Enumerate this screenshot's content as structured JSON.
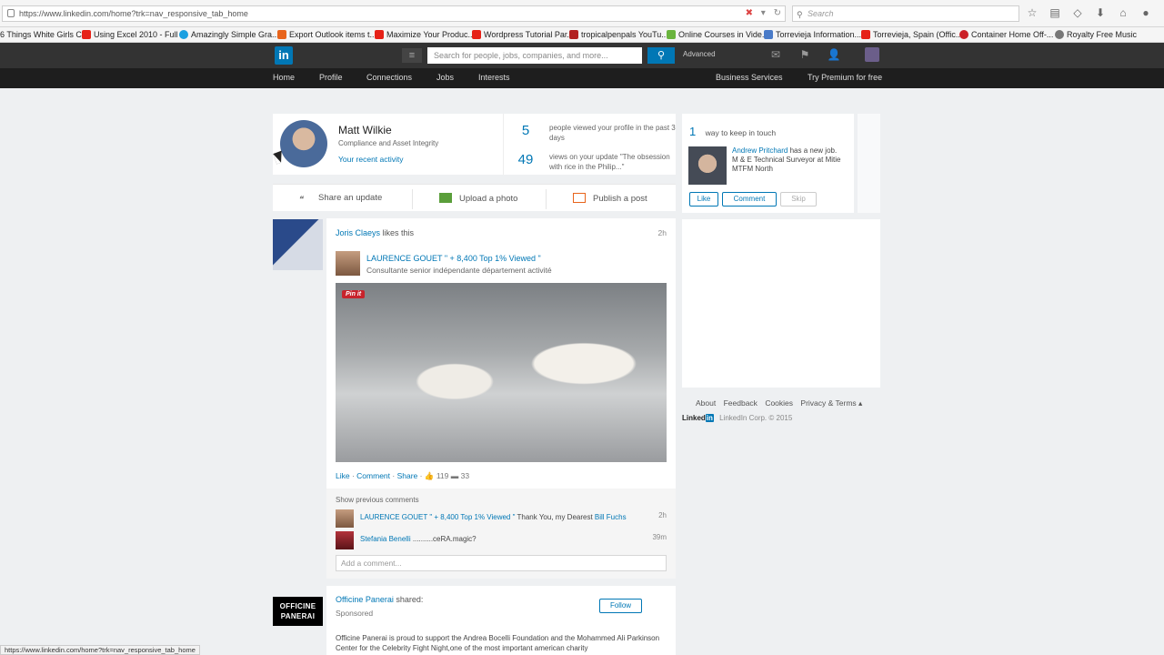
{
  "browser": {
    "url": "https://www.linkedin.com/home?trk=nav_responsive_tab_home",
    "search_placeholder": "Search",
    "status_url": "https://www.linkedin.com/home?trk=nav_responsive_tab_home",
    "bookmarks": [
      {
        "label": "6 Things White Girls C...",
        "color": "#ffffff"
      },
      {
        "label": "Using Excel 2010 - Full ...",
        "color": "#e62117"
      },
      {
        "label": "Amazingly Simple Gra...",
        "color": "#1ba0e1"
      },
      {
        "label": "Export Outlook items t...",
        "color": "#e8641b"
      },
      {
        "label": "Maximize Your Produc...",
        "color": "#e62117"
      },
      {
        "label": "Wordpress Tutorial Par...",
        "color": "#e62117"
      },
      {
        "label": "tropicalpenpals YouTu...",
        "color": "#b22222"
      },
      {
        "label": "Online Courses in Vide...",
        "color": "#6ab43e"
      },
      {
        "label": "Torrevieja Information...",
        "color": "#4a7bc8"
      },
      {
        "label": "Torrevieja, Spain (Offic...",
        "color": "#e62117"
      },
      {
        "label": "Container Home Off-...",
        "color": "#cb2027"
      },
      {
        "label": "Royalty Free Music",
        "color": "#777777"
      }
    ]
  },
  "nav": {
    "logo": "in",
    "search_placeholder": "Search for people, jobs, companies, and more...",
    "advanced": "Advanced",
    "tabs": [
      "Home",
      "Profile",
      "Connections",
      "Jobs",
      "Interests"
    ],
    "business": "Business Services",
    "premium": "Try Premium for free"
  },
  "profile": {
    "name": "Matt Wilkie",
    "headline": "Compliance and Asset Integrity",
    "activity": "Your recent activity",
    "stat1_num": "5",
    "stat1_text": "people viewed your profile in the past 3 days",
    "stat2_num": "49",
    "stat2_text": "views on your update \"The obsession with rice in the Philip...\""
  },
  "share": {
    "update": "Share an update",
    "photo": "Upload a photo",
    "post": "Publish a post"
  },
  "feed": {
    "actor": "Joris Claeys",
    "action": "likes this",
    "time": "2h",
    "author": "LAURENCE GOUET \" + 8,400 Top 1% Viewed \"",
    "author_sub": "Consultante senior indépendante département activité",
    "pinit": "Pin it",
    "like": "Like",
    "comment": "Comment",
    "share": "Share",
    "likes_count": "119",
    "comments_count": "33",
    "show_prev": "Show previous comments",
    "comments": [
      {
        "name": "LAURENCE GOUET \" + 8,400 Top 1% Viewed \"",
        "text": "Thank You, my Dearest",
        "mention": "Bill Fuchs",
        "time": "2h"
      },
      {
        "name": "Stefania Benelli",
        "text": "..........ceRA.magic?",
        "mention": "",
        "time": "39m"
      }
    ],
    "add_comment": "Add a comment..."
  },
  "feed2": {
    "logo": "OFFICINE PANERAI",
    "name": "Officine Panerai",
    "action": "shared:",
    "sponsored": "Sponsored",
    "follow": "Follow",
    "text": "Officine Panerai is proud to support the Andrea Bocelli Foundation and the Mohammed Ali Parkinson Center for the Celebrity Fight Night,one of the most important american charity"
  },
  "keep_in_touch": {
    "num": "1",
    "title": "way to keep in touch",
    "name": "Andrew Pritchard",
    "action": "has a new job.",
    "detail": "M & E Technical Surveyor at Mitie MTFM North",
    "like": "Like",
    "comment": "Comment",
    "skip": "Skip"
  },
  "footer": {
    "links": [
      "About",
      "Feedback",
      "Cookies",
      "Privacy & Terms ▴"
    ],
    "brand": "Linked",
    "brand_in": "in",
    "copyright": "LinkedIn Corp. © 2015"
  }
}
